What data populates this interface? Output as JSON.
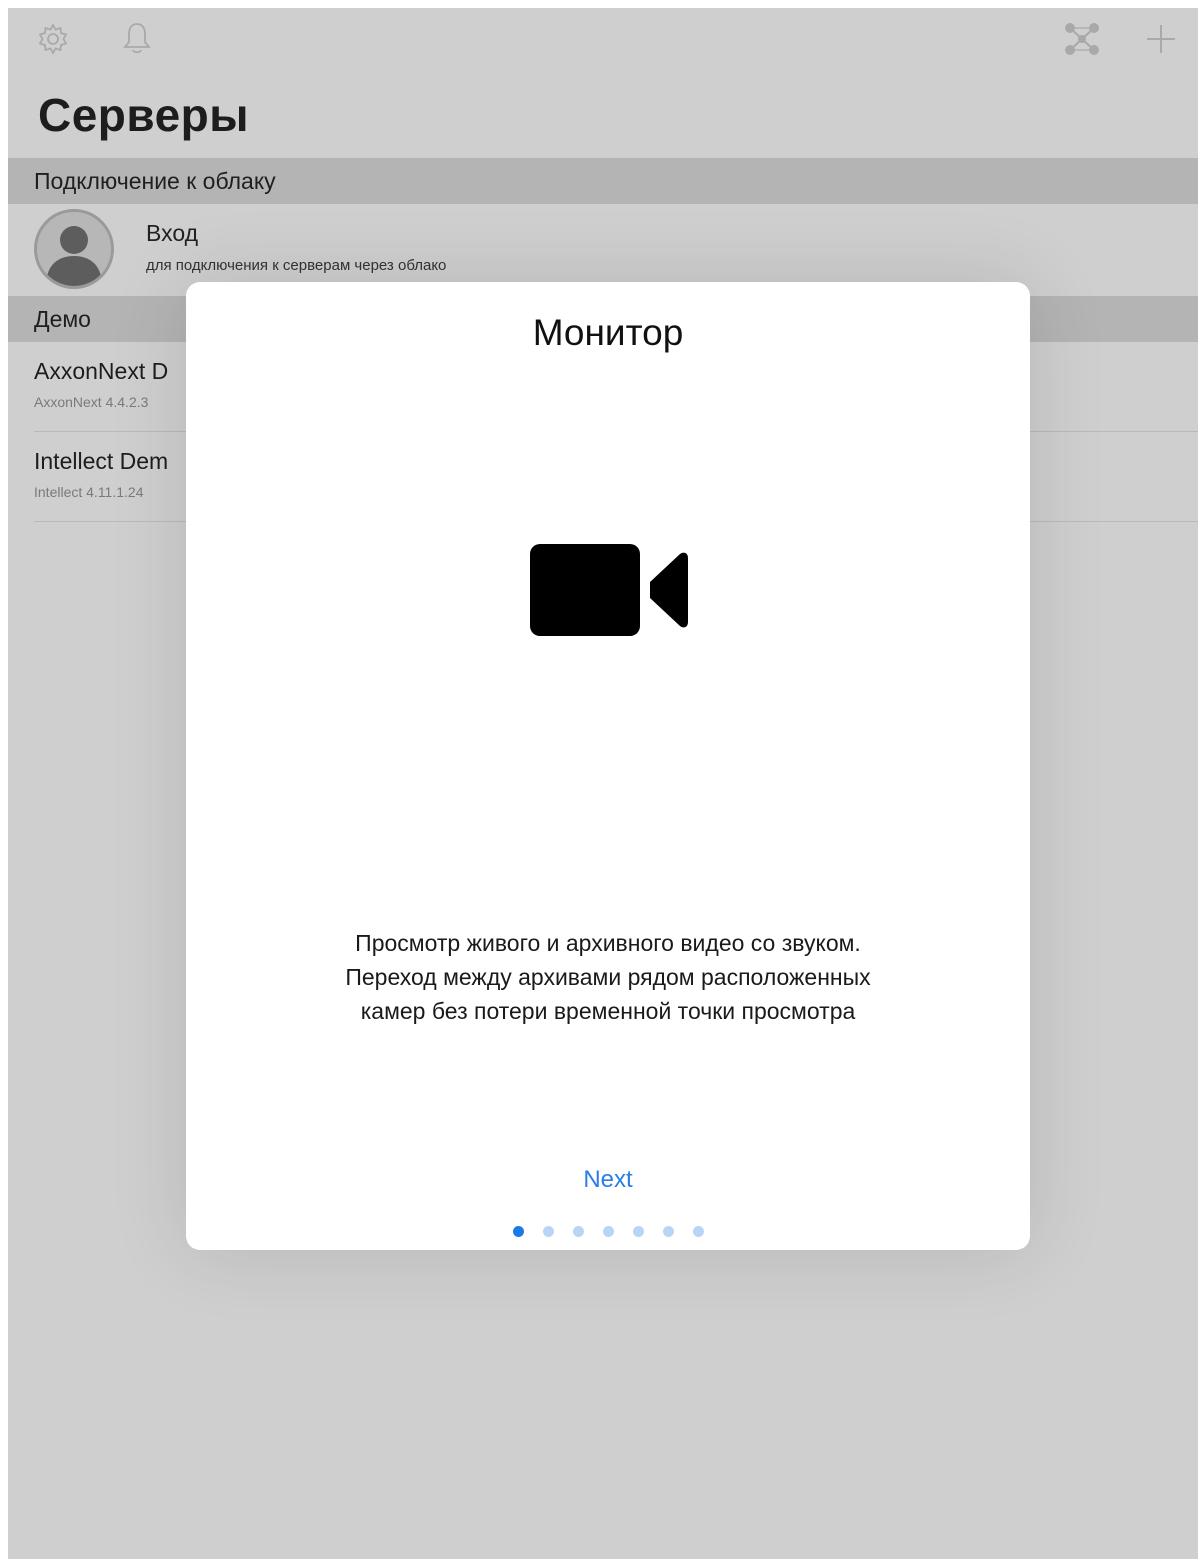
{
  "toolbar": {
    "left_icons": [
      "gear-icon",
      "bell-icon"
    ],
    "right_icons": [
      "network-icon",
      "plus-icon"
    ]
  },
  "page": {
    "title": "Серверы"
  },
  "cloud_section": {
    "header": "Подключение к облаку",
    "login_title": "Вход",
    "login_subtitle": "для подключения к серверам через облако"
  },
  "demo_section": {
    "header": "Демо",
    "servers": [
      {
        "name": "AxxonNext D",
        "subtitle": "AxxonNext 4.4.2.3"
      },
      {
        "name": "Intellect Dem",
        "subtitle": "Intellect 4.11.1.24"
      }
    ]
  },
  "modal": {
    "title": "Монитор",
    "icon": "video-camera-icon",
    "description_lines": [
      "Просмотр живого и архивного видео со звуком.",
      "Переход между архивами рядом расположенных",
      "камер без потери временной точки просмотра"
    ],
    "next_label": "Next",
    "page_count": 7,
    "current_page": 1
  },
  "colors": {
    "accent": "#1a7ae6",
    "dimmed_background": "#cfcfcf",
    "section_header": "#b4b4b4"
  }
}
